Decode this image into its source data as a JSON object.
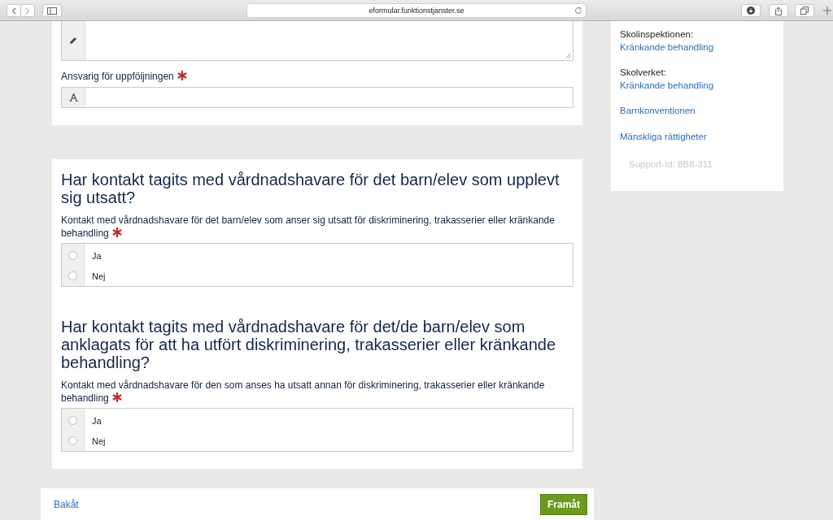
{
  "browser": {
    "url": "eformular.funktionstjanster.se"
  },
  "top_fields": [
    {
      "kind": "textarea"
    },
    {
      "kind": "text",
      "label": "Ansvarig för uppföljningen",
      "required": true
    }
  ],
  "questions": [
    {
      "title": "Har kontakt tagits med vårdnadshavare för det barn/elev som upplevt sig utsatt?",
      "description": "Kontakt med vårdnadshavare för det barn/elev som anser sig utsatt för diskriminering, trakasserier eller kränkande behandling",
      "required": true,
      "options": [
        {
          "label": "Ja",
          "selected": false
        },
        {
          "label": "Nej",
          "selected": false
        }
      ]
    },
    {
      "title": "Har kontakt tagits med vårdnadshavare för det/de barn/elev som anklagats för att ha utfört diskriminering, trakasserier eller kränkande behandling?",
      "description": "Kontakt med vårdnadshavare för den som anses ha utsatt annan för diskriminering, trakasserier eller kränkande behandling",
      "required": true,
      "options": [
        {
          "label": "Ja",
          "selected": false
        },
        {
          "label": "Nej",
          "selected": false
        }
      ]
    }
  ],
  "sidebar": {
    "links": [
      {
        "heading": "Skolinspektionen:",
        "label": "Kränkande behandling"
      },
      {
        "heading": "Skolverket:",
        "label": "Kränkande behandling"
      },
      {
        "label": "Barnkonventionen"
      },
      {
        "label": "Mänskliga rättigheter"
      }
    ],
    "support_id": "Support-Id: 8B8-311"
  },
  "nav": {
    "back": "Bakåt",
    "next": "Framåt"
  }
}
